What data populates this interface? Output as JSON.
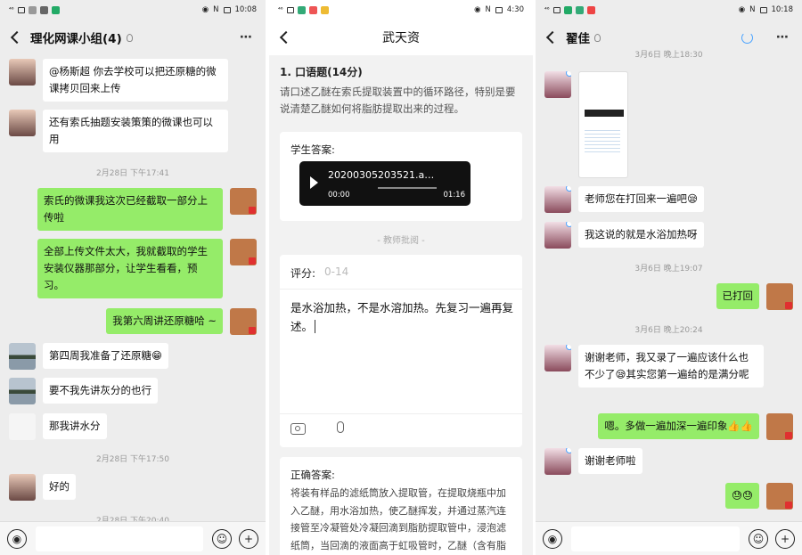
{
  "panel1": {
    "status_time": "10:08",
    "title": "理化网课小组(4)",
    "messages": [
      {
        "text": "@杨斯超  你去学校可以把还原糖的微课拷贝回来上传"
      },
      {
        "text": "还有索氏抽题安装策策的微课也可以用"
      },
      {
        "text": "索氏的微课我这次已经截取一部分上传啦"
      },
      {
        "text": "全部上传文件太大，我就截取的学生安装仪器那部分，让学生看看，预习。"
      },
      {
        "text": "我第六周讲还原糖哈 ~"
      },
      {
        "text": "第四周我准备了还原糖😁"
      },
      {
        "text": "要不我先讲灰分的也行"
      },
      {
        "text": "那我讲水分"
      },
      {
        "text": "好的"
      }
    ],
    "timestamps": [
      "2月28日 下午17:41",
      "2月28日 下午17:50",
      "2月28日 下午20:40"
    ]
  },
  "panel2": {
    "status_time": "4:30",
    "title": "武天资",
    "question_title": "1. 口语题(14分)",
    "question_text": "请口述乙醚在索氏提取装置中的循环路径，特别是要说清楚乙醚如何将脂肪提取出来的过程。",
    "answer_label": "学生答案:",
    "audio_name": "20200305203521.a…",
    "audio_start": "00:00",
    "audio_end": "01:16",
    "review_label": "- 教师批阅 -",
    "score_label": "评分:",
    "score_placeholder": "0-14",
    "comment": "是水浴加热，不是水溶加热。先复习一遍再复述。",
    "correct_label": "正确答案:",
    "correct_text": "将装有样品的滤纸筒放入提取管，在提取烧瓶中加入乙醚，用水浴加热，使乙醚挥发，并通过蒸汽连接管至冷凝管处冷凝回滴到脂肪提取管中，浸泡滤纸筒，当回滴的液面高于虹吸管时，乙醚（含有脂肪）回流到提取烧瓶中，完成一个循"
  },
  "panel3": {
    "status_time": "10:18",
    "title": "翟佳",
    "timestamps": [
      "3月6日 晚上18:30",
      "3月6日 晚上19:07",
      "3月6日 晚上20:24"
    ],
    "messages": [
      {
        "text": "老师您在打回来一遍吧😪"
      },
      {
        "text": "我这说的就是水浴加热呀"
      },
      {
        "text": "已打回"
      },
      {
        "text": "谢谢老师，我又录了一遍应该什么也不少了😪其实您第一遍给的是满分呢"
      },
      {
        "text": "嗯。多做一遍加深一遍印象👍👍"
      },
      {
        "text": "谢谢老师啦"
      },
      {
        "text": "😓😓"
      }
    ]
  },
  "icons": {
    "more": "⋯",
    "voice": "◉",
    "emoji": "☺",
    "plus": "+"
  }
}
